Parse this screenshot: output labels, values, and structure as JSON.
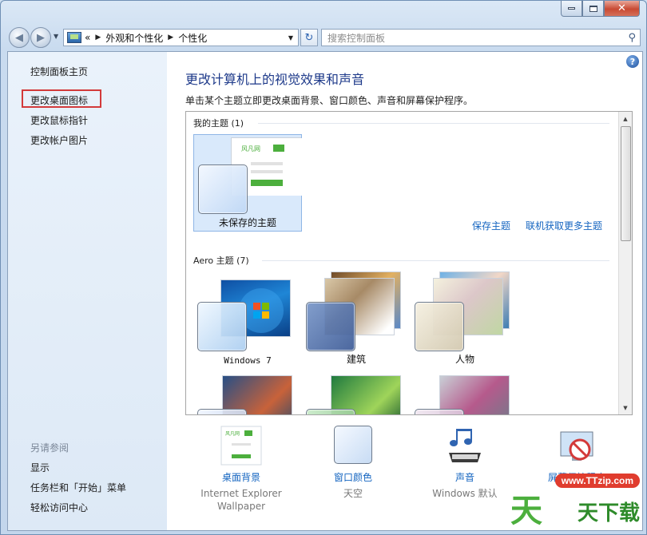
{
  "window": {
    "buttons": {
      "minimize": "minimize",
      "maximize": "maximize",
      "close": "close"
    }
  },
  "navbar": {
    "breadcrumb_overflow": "«",
    "breadcrumbs": [
      "外观和个性化",
      "个性化"
    ],
    "search_placeholder": "搜索控制面板"
  },
  "sidebar": {
    "items": [
      {
        "label": "控制面板主页"
      },
      {
        "label": "更改桌面图标"
      },
      {
        "label": "更改鼠标指针"
      },
      {
        "label": "更改帐户图片"
      }
    ],
    "see_also_heading": "另请参阅",
    "see_also": [
      {
        "label": "显示"
      },
      {
        "label": "任务栏和「开始」菜单"
      },
      {
        "label": "轻松访问中心"
      }
    ]
  },
  "main": {
    "title": "更改计算机上的视觉效果和声音",
    "description": "单击某个主题立即更改桌面背景、窗口颜色、声音和屏幕保护程序。",
    "my_themes_heading": "我的主题 (1)",
    "my_themes": [
      {
        "name": "未保存的主题"
      }
    ],
    "save_theme_link": "保存主题",
    "more_themes_link": "联机获取更多主题",
    "aero_heading": "Aero 主题 (7)",
    "aero_themes": [
      {
        "name": "Windows 7"
      },
      {
        "name": "建筑"
      },
      {
        "name": "人物"
      }
    ]
  },
  "bottom": [
    {
      "label": "桌面背景",
      "sub": "Internet Explorer Wallpaper"
    },
    {
      "label": "窗口颜色",
      "sub": "天空"
    },
    {
      "label": "声音",
      "sub": "Windows 默认"
    },
    {
      "label": "屏幕保护程序",
      "sub": ""
    }
  ],
  "watermark": {
    "url": "www.TTzip.com",
    "text": "天下载"
  },
  "colors": {
    "link": "#1565c0",
    "title": "#1e3a8a",
    "highlight_box": "#d33a3a"
  }
}
